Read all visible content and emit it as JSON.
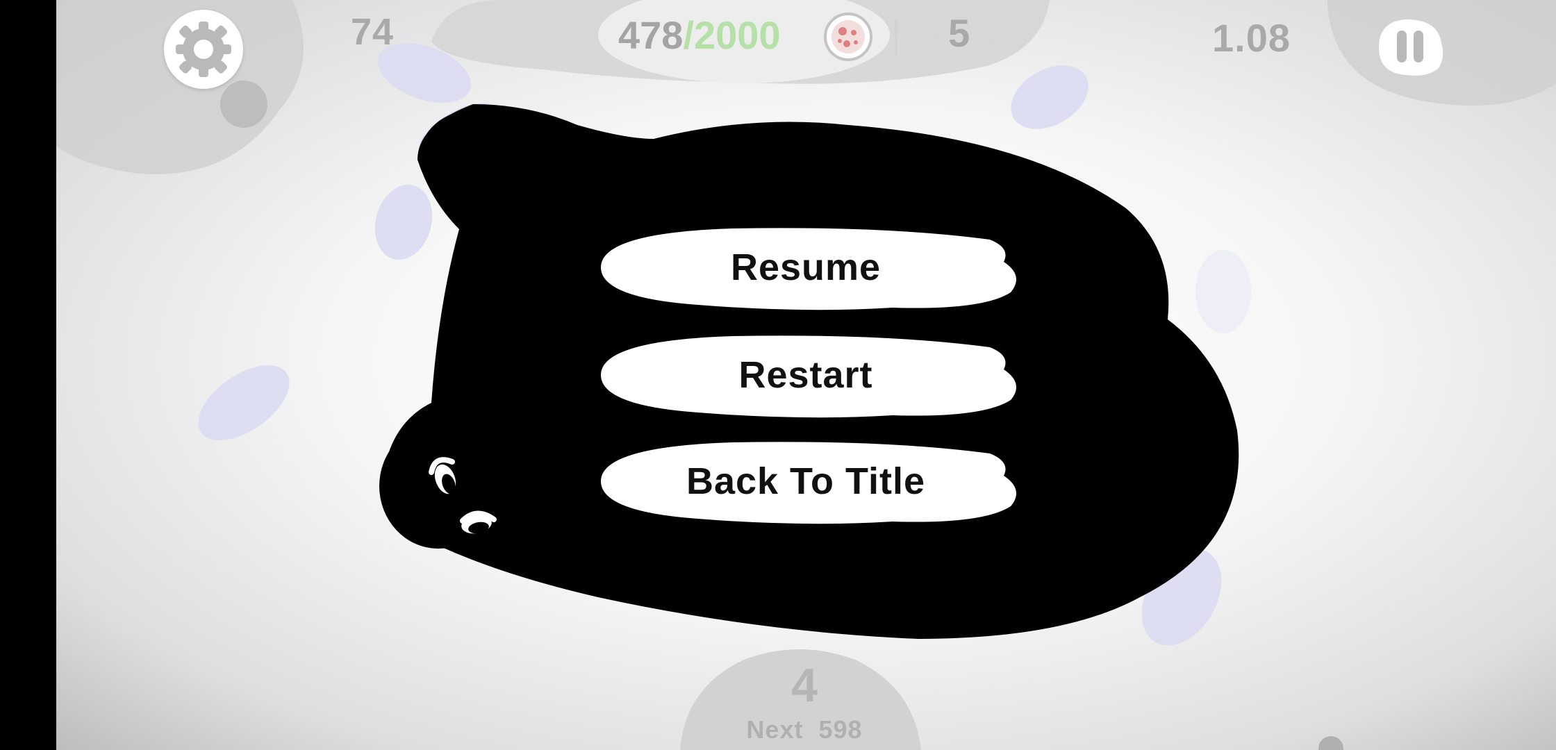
{
  "hud": {
    "left_counter": "74",
    "progress_current": "478",
    "progress_separator": "/",
    "progress_goal": "2000",
    "right_count": "5",
    "multiplier": "1.08"
  },
  "pause_menu": {
    "resume_label": "Resume",
    "restart_label": "Restart",
    "back_to_title_label": "Back To Title"
  },
  "level": {
    "number": "4",
    "next_label": "Next",
    "next_value": "598"
  },
  "colors": {
    "menu_blob": "#000000",
    "button_fill": "#ffffff",
    "hud_text": "#a9a9a9",
    "goal_text": "#b5e0a8",
    "splat": "#d9d9f2"
  },
  "icons": {
    "settings": "gear-icon",
    "pause": "pause-icon",
    "cell_counter": "petri-dish-icon"
  }
}
